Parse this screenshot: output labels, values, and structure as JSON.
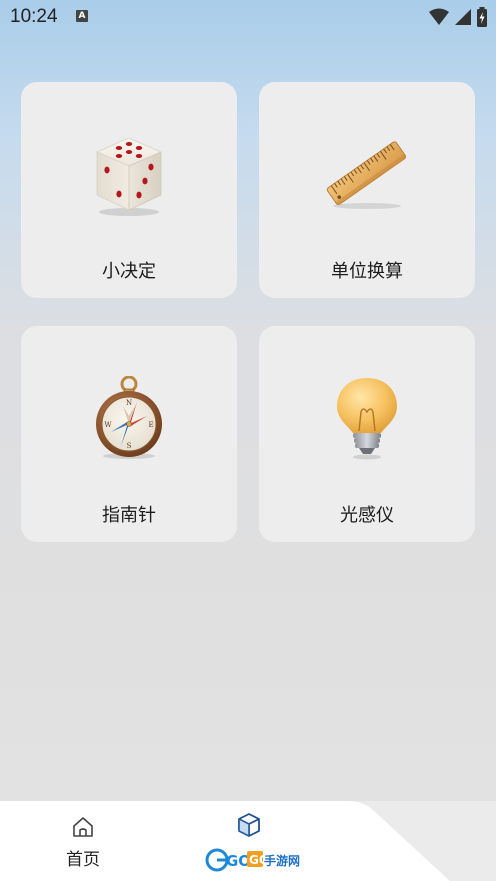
{
  "status_bar": {
    "time": "10:24",
    "notification_icon": "a-letter-icon",
    "icons": [
      "wifi-icon",
      "signal-icon",
      "battery-icon"
    ]
  },
  "tools": [
    {
      "label": "小决定",
      "icon": "dice-icon"
    },
    {
      "label": "单位换算",
      "icon": "ruler-icon"
    },
    {
      "label": "指南针",
      "icon": "compass-icon"
    },
    {
      "label": "光感仪",
      "icon": "lightbulb-icon"
    }
  ],
  "bottom_nav": {
    "home_label": "首页",
    "home_icon": "home-icon",
    "tools_icon": "cube-icon",
    "active_color": "#2b6fd6"
  },
  "watermark": {
    "text": "GOGO手游网"
  }
}
